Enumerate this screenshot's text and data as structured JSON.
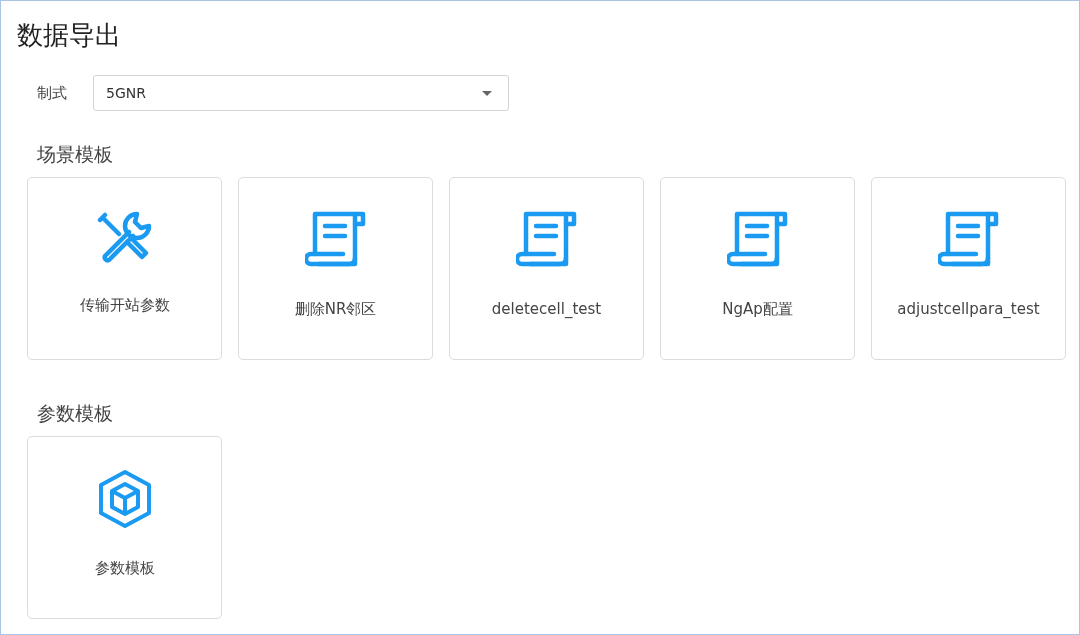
{
  "title": "数据导出",
  "standard": {
    "label": "制式",
    "value": "5GNR"
  },
  "sections": [
    {
      "heading": "场景模板",
      "cards": [
        {
          "kind": "tools",
          "label": "传输开站参数"
        },
        {
          "kind": "scroll",
          "label": "删除NR邻区"
        },
        {
          "kind": "scroll",
          "label": "deletecell_test"
        },
        {
          "kind": "scroll",
          "label": "NgAp配置"
        },
        {
          "kind": "scroll",
          "label": "adjustcellpara_test"
        }
      ]
    },
    {
      "heading": "参数模板",
      "cards": [
        {
          "kind": "cube",
          "label": "参数模板"
        }
      ]
    }
  ]
}
